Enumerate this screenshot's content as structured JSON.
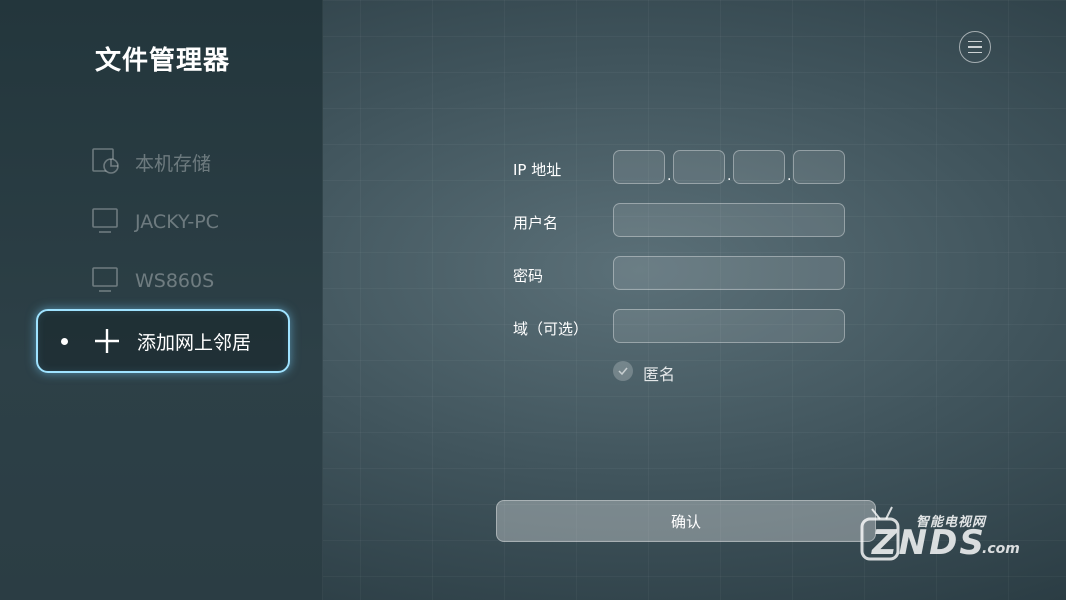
{
  "app": {
    "title": "文件管理器"
  },
  "menu_button": {
    "icon": "hamburger-menu-icon"
  },
  "sidebar": {
    "items": [
      {
        "label": "本机存储",
        "icon": "local-storage-pie-icon"
      },
      {
        "label": "JACKY-PC",
        "icon": "monitor-icon"
      },
      {
        "label": "WS860S",
        "icon": "monitor-icon"
      },
      {
        "label": "添加网上邻居",
        "icon": "plus-icon",
        "active": true
      }
    ]
  },
  "form": {
    "ip_label": "IP 地址",
    "ip_separator": ".",
    "username_label": "用户名",
    "password_label": "密码",
    "domain_label": "域（可选）",
    "anonymous_label": "匿名",
    "confirm_label": "确认"
  },
  "watermark": {
    "top_text": "智能电视网",
    "brand": "ZNDS",
    "suffix": ".com"
  },
  "colors": {
    "accent_glow": "#9fe3ff",
    "background_center": "#5b7078",
    "sidebar_bg": "#23363c"
  }
}
